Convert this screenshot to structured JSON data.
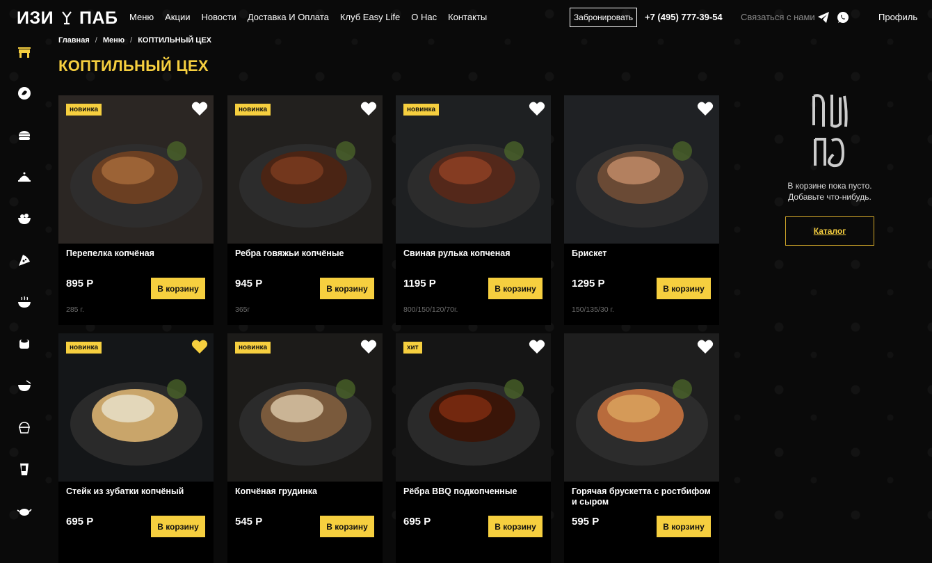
{
  "header": {
    "logo_left": "ИЗИ",
    "logo_right": "ПАБ",
    "nav": [
      "Меню",
      "Акции",
      "Новости",
      "Доставка И Оплата",
      "Клуб Easy Life",
      "О Нас",
      "Контакты"
    ],
    "book_label": "Забронировать",
    "phone": "+7 (495) 777-39-54",
    "contact_label": "Связаться с нами",
    "profile_label": "Профиль"
  },
  "breadcrumb": [
    "Главная",
    "Меню",
    "КОПТИЛЬНЫЙ ЦЕХ"
  ],
  "page_title": "КОПТИЛЬНЫЙ ЦЕХ",
  "colors": {
    "accent": "#f6cf3f",
    "background": "#0a0a0a"
  },
  "sidebar_icons": [
    "chair-icon",
    "leaf-icon",
    "burger-icon",
    "cloche-icon",
    "salad-icon",
    "pizza-icon",
    "soup-icon",
    "sushi-icon",
    "bowl-icon",
    "cupcake-icon",
    "glass-icon",
    "teapot-icon"
  ],
  "products": [
    {
      "name": "Перепелка копчёная",
      "price": "895 Р",
      "weight": "285 г.",
      "badge": "новинка",
      "favorite": false,
      "cart_label": "В корзину"
    },
    {
      "name": "Ребра говяжьи копчёные",
      "price": "945 Р",
      "weight": "365г",
      "badge": "новинка",
      "favorite": false,
      "cart_label": "В корзину"
    },
    {
      "name": "Свиная рулька копченая",
      "price": "1195 Р",
      "weight": "800/150/120/70г.",
      "badge": "новинка",
      "favorite": false,
      "cart_label": "В корзину"
    },
    {
      "name": "Брискет",
      "price": "1295 Р",
      "weight": "150/135/30 г.",
      "badge": "",
      "favorite": false,
      "cart_label": "В корзину"
    },
    {
      "name": "Стейк из зубатки копчёный",
      "price": "695 Р",
      "weight": "",
      "badge": "новинка",
      "favorite": true,
      "cart_label": "В корзину"
    },
    {
      "name": "Копчёная грудинка",
      "price": "545 Р",
      "weight": "",
      "badge": "новинка",
      "favorite": false,
      "cart_label": "В корзину"
    },
    {
      "name": "Рёбра BBQ подкопченные",
      "price": "695 Р",
      "weight": "",
      "badge": "хит",
      "favorite": false,
      "cart_label": "В корзину"
    },
    {
      "name": "Горячая брускетта с ростбифом и сыром",
      "price": "595 Р",
      "weight": "",
      "badge": "",
      "favorite": false,
      "cart_label": "В корзину"
    }
  ],
  "cart": {
    "empty_line1": "В корзине пока пусто.",
    "empty_line2": "Добавьте что-нибудь.",
    "catalog_label": "Каталог"
  }
}
